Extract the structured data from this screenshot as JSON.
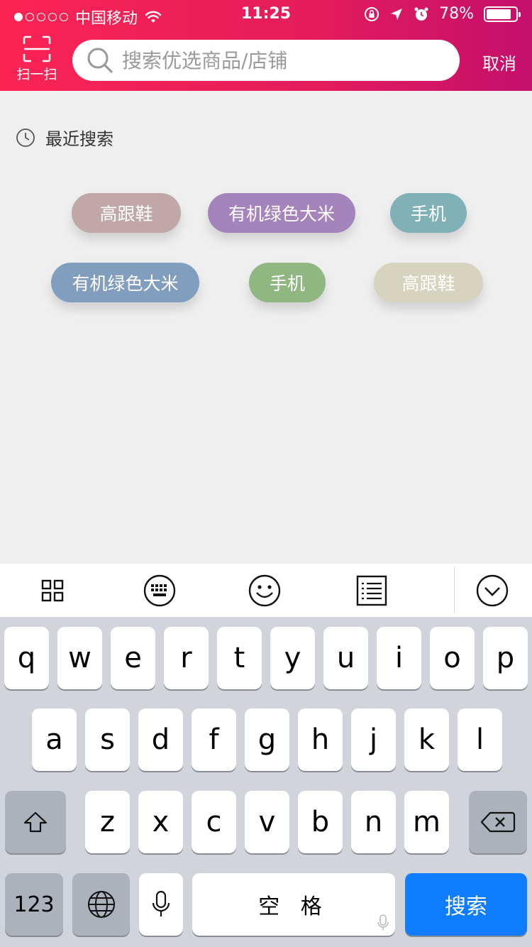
{
  "status_bar": {
    "carrier": "中国移动",
    "time": "11:25",
    "battery": "78%"
  },
  "header": {
    "scan_label": "扫一扫",
    "search_placeholder": "搜索优选商品/店铺",
    "cancel_label": "取消"
  },
  "history": {
    "title": "最近搜索",
    "tags": [
      {
        "label": "高跟鞋",
        "color": "#c1a7a8"
      },
      {
        "label": "有机绿色大米",
        "color": "#a584bc"
      },
      {
        "label": "手机",
        "color": "#80b1b6"
      },
      {
        "label": "有机绿色大米",
        "color": "#829ebe"
      },
      {
        "label": "手机",
        "color": "#90b681"
      },
      {
        "label": "高跟鞋",
        "color": "#d6d4be"
      }
    ]
  },
  "keyboard": {
    "row1": [
      "q",
      "w",
      "e",
      "r",
      "t",
      "y",
      "u",
      "i",
      "o",
      "p"
    ],
    "row2": [
      "a",
      "s",
      "d",
      "f",
      "g",
      "h",
      "j",
      "k",
      "l"
    ],
    "row3": [
      "z",
      "x",
      "c",
      "v",
      "b",
      "n",
      "m"
    ],
    "numbers_label": "123",
    "space_label": "空 格",
    "search_label": "搜索"
  },
  "colors": {
    "header_start": "#fb2453",
    "header_end": "#c40f6c",
    "search_key": "#107dfe"
  }
}
